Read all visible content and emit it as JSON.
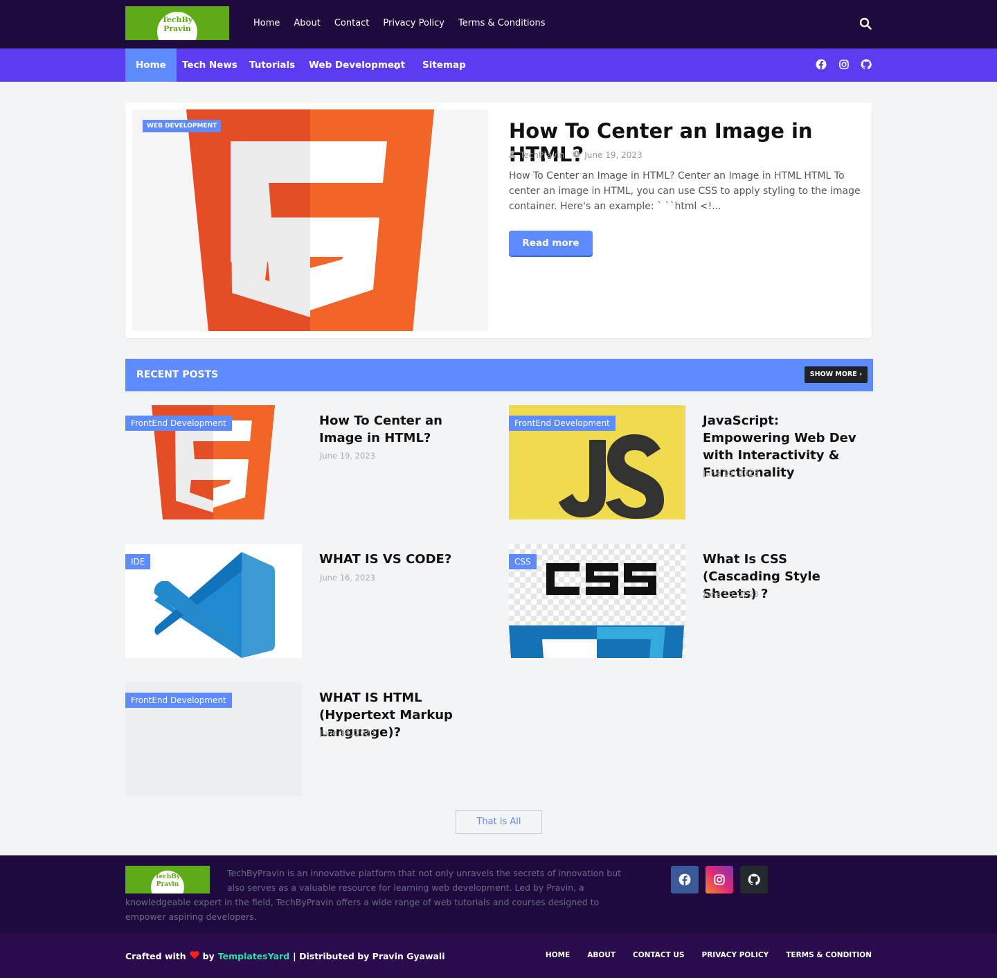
{
  "brand": {
    "logo_line1": "TechBy",
    "logo_line2": "Pravin",
    "logo_color": "#5faa17"
  },
  "top_nav": [
    "Home",
    "About",
    "Contact",
    "Privacy Policy",
    "Terms & Conditions"
  ],
  "main_nav": [
    "Home",
    "Tech News",
    "Tutorials",
    "Web Development",
    "Sitemap"
  ],
  "featured": {
    "category": "WEB DEVELOPMENT",
    "title": "How To Center an Image in HTML?",
    "author": "TechPravin",
    "date": "June 19, 2023",
    "snippet": "How To Center an Image in HTML? Center an Image in HTML HTML To center an image in HTML, you can use CSS to apply styling to the image container. Here's an example: ` ``html <!...",
    "read_more": "Read more",
    "image_icon": "html5-logo"
  },
  "recent": {
    "heading": "RECENT POSTS",
    "show_more": "SHOW MORE ›",
    "posts": [
      {
        "category": "FrontEnd Development",
        "title": "How To Center an Image in HTML?",
        "date": "June 19, 2023",
        "image_icon": "html5-logo"
      },
      {
        "category": "FrontEnd Development",
        "title": "JavaScript: Empowering Web Dev with Interactivity & Functionality",
        "date": "June 16, 2023",
        "image_icon": "js-logo"
      },
      {
        "category": "IDE",
        "title": "WHAT IS VS CODE?",
        "date": "June 16, 2023",
        "image_icon": "vscode-logo"
      },
      {
        "category": "CSS",
        "title": "What Is CSS (Cascading Style Sheets) ?",
        "date": "June 15, 2023",
        "image_icon": "css-logo"
      },
      {
        "category": "FrontEnd Development",
        "title": "WHAT IS HTML (Hypertext Markup Language)?",
        "date": "June 14, 2023",
        "image_icon": "blank"
      }
    ],
    "end_label": "That is All"
  },
  "footer": {
    "about": "TechByPravin is an innovative platform that not only unravels the secrets of innovation but also serves as a valuable resource for learning web development. Led by Pravin, a knowledgeable expert in the field, TechByPravin offers a wide range of web tutorials and courses designed to empower aspiring developers.",
    "social": [
      "facebook-icon",
      "instagram-icon",
      "github-icon"
    ],
    "crafted_prefix": "Crafted with",
    "crafted_by": "by",
    "templates_link": "TemplatesYard",
    "distributed": "| Distributed by Pravin Gyawali",
    "links": [
      "HOME",
      "ABOUT",
      "CONTACT US",
      "PRIVACY POLICY",
      "TERMS & CONDITION"
    ]
  },
  "colors": {
    "topbar": "#1e0a3c",
    "navbar": "#5b3cf0",
    "accent": "#5e8bff",
    "footer": "#1e0a3c"
  }
}
